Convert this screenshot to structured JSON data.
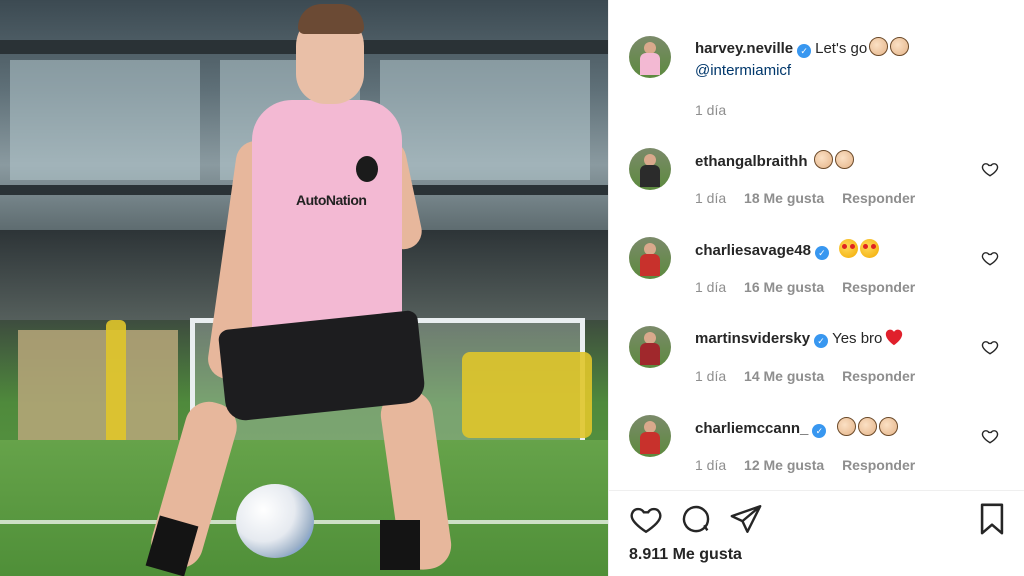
{
  "post": {
    "photo_sponsor": "AutoNation"
  },
  "caption": {
    "username": "harvey.neville",
    "text": "Let's go",
    "emojis": [
      "clapping-hands",
      "clapping-hands"
    ],
    "mention": "@intermiamicf",
    "time": "1 día"
  },
  "comments": [
    {
      "username": "ethangalbraithh",
      "emojis": [
        "clapping-hands",
        "clapping-hands"
      ],
      "text": "",
      "time": "1 día",
      "likes": "18 Me gusta",
      "reply": "Responder",
      "avatar_color": "#2b2b2b"
    },
    {
      "username": "charliesavage48",
      "emojis": [
        "heart-eyes",
        "heart-eyes"
      ],
      "text": "",
      "time": "1 día",
      "likes": "16 Me gusta",
      "reply": "Responder",
      "avatar_color": "#c8312c"
    },
    {
      "username": "martinsvidersky",
      "emojis": [
        "red-heart"
      ],
      "text": "Yes bro",
      "time": "1 día",
      "likes": "14 Me gusta",
      "reply": "Responder",
      "avatar_color": "#a0282c"
    },
    {
      "username": "charliemccann_",
      "emojis": [
        "clapping-hands",
        "clapping-hands",
        "clapping-hands"
      ],
      "text": "",
      "time": "1 día",
      "likes": "12 Me gusta",
      "reply": "Responder",
      "avatar_color": "#c8312c"
    }
  ],
  "footer": {
    "likes_count": "8.911 Me gusta"
  },
  "colors": {
    "verified": "#3897f0",
    "mention": "#00376b",
    "muted": "#8e8e8e",
    "kit_pink": "#f3b9d3"
  }
}
